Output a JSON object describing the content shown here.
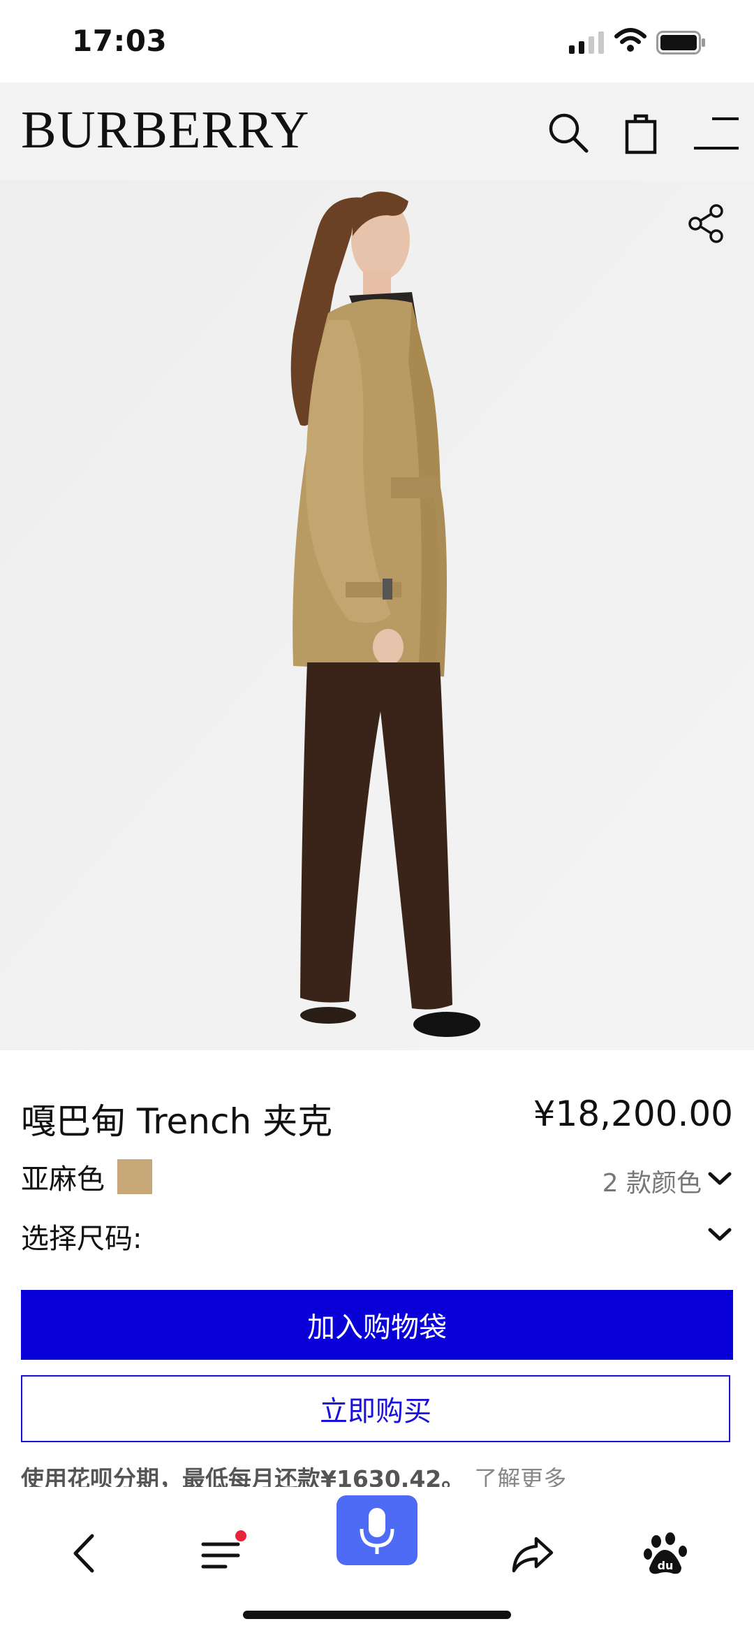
{
  "status": {
    "time": "17:03"
  },
  "header": {
    "brand": "BURBERRY"
  },
  "product": {
    "title": "嘎巴甸 Trench 夹克",
    "price": "¥18,200.00",
    "color_label": "亚麻色",
    "color_swatch": "#c8a878",
    "color_count": "2 款颜色",
    "size_label": "选择尺码:"
  },
  "actions": {
    "add_to_bag": "加入购物袋",
    "buy_now": "立即购买"
  },
  "installment": {
    "text": "使用花呗分期，最低每月还款¥1630.42。",
    "link": "了解更多"
  },
  "colors": {
    "primary_button": "#0a00d8",
    "voice_button": "#4d6bf5",
    "notification_dot": "#e8233a"
  }
}
